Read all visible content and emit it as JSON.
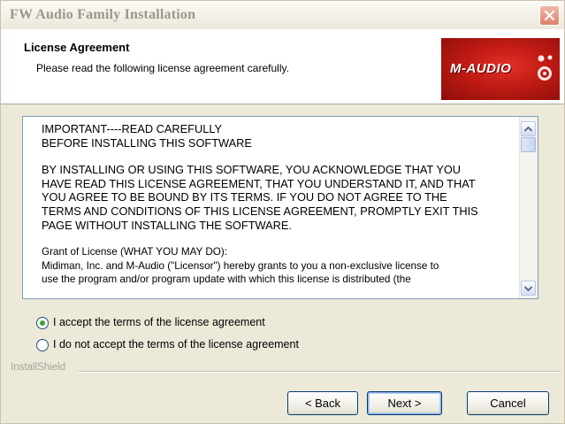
{
  "window": {
    "title": "FW Audio Family Installation"
  },
  "header": {
    "title": "License Agreement",
    "subtitle": "Please read the following license agreement carefully.",
    "logo_text": "M-AUDIO"
  },
  "license": {
    "paragraphs": [
      "IMPORTANT----READ CAREFULLY\nBEFORE INSTALLING THIS SOFTWARE",
      "BY INSTALLING OR USING THIS SOFTWARE, YOU ACKNOWLEDGE THAT YOU\nHAVE READ THIS LICENSE AGREEMENT, THAT YOU UNDERSTAND IT, AND THAT\nYOU AGREE TO BE BOUND BY ITS TERMS.  IF YOU DO NOT AGREE TO THE\nTERMS AND CONDITIONS OF THIS LICENSE AGREEMENT, PROMPTLY EXIT THIS\nPAGE WITHOUT INSTALLING THE SOFTWARE.",
      "Grant of License  (WHAT YOU MAY DO):\nMidiman, Inc. and M-Audio  (\"Licensor\") hereby grants to you a non-exclusive license to\nuse the program and/or program update with which this license is distributed (the"
    ]
  },
  "options": {
    "accept_label": "I accept the terms of the license agreement",
    "decline_label": "I do not accept the terms of the license agreement",
    "selected": "accept"
  },
  "footer": {
    "brand": "InstallShield",
    "back_label": "< Back",
    "next_label": "Next >",
    "cancel_label": "Cancel"
  },
  "colors": {
    "dialog_bg": "#ece9d8",
    "logo_red": "#c41e17",
    "radio_selected": "#38a52b",
    "close_button": "#e0806a"
  },
  "icons": {
    "close": "close-icon",
    "scroll_up": "scroll-up-arrow-icon",
    "scroll_down": "scroll-down-arrow-icon"
  }
}
